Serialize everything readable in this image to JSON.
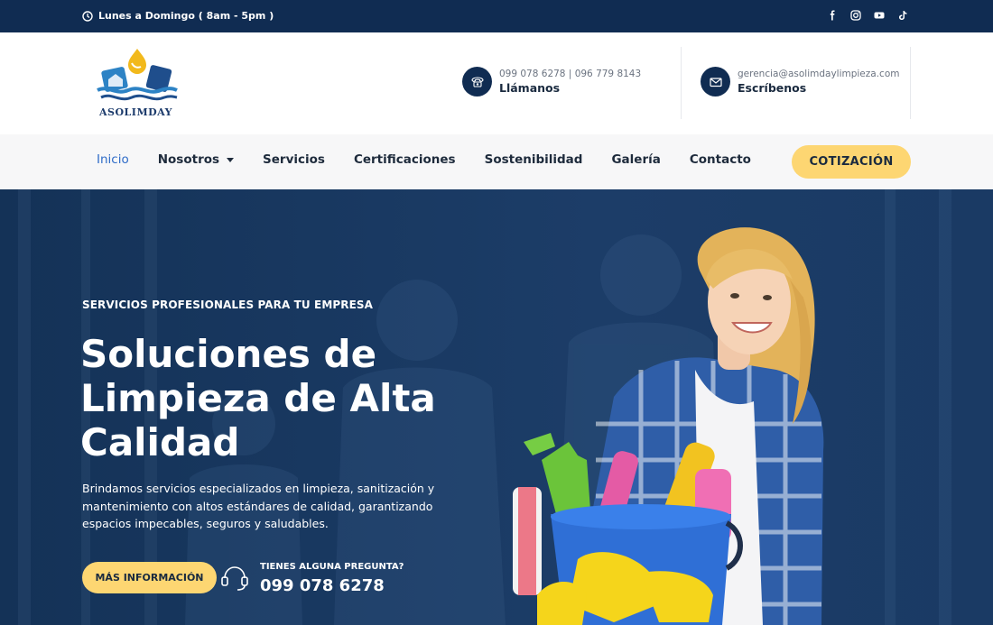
{
  "topbar": {
    "hours": "Lunes a Domingo ( 8am - 5pm )",
    "social": [
      "facebook-icon",
      "instagram-icon",
      "youtube-icon",
      "tiktok-icon"
    ]
  },
  "header": {
    "logo_text": "ASOLIMDAY",
    "phone": {
      "numbers": "099 078 6278 | 096 779 8143",
      "label": "Llámanos"
    },
    "email": {
      "address": "gerencia@asolimdaylimpieza.com",
      "label": "Escríbenos"
    }
  },
  "nav": {
    "items": [
      {
        "label": "Inicio",
        "active": true
      },
      {
        "label": "Nosotros",
        "dropdown": true
      },
      {
        "label": "Servicios"
      },
      {
        "label": "Certificaciones"
      },
      {
        "label": "Sostenibilidad"
      },
      {
        "label": "Galería"
      },
      {
        "label": "Contacto"
      }
    ],
    "cta": "COTIZACIÓN"
  },
  "hero": {
    "kicker": "SERVICIOS PROFESIONALES PARA TU EMPRESA",
    "title": "Soluciones de Limpieza de Alta Calidad",
    "description": "Brindamos servicios especializados en limpieza, sanitización y mantenimiento con altos estándares de calidad, garantizando espacios impecables, seguros y saludables.",
    "button": "MÁS INFORMACIÓN",
    "question_label": "TIENES ALGUNA PREGUNTA?",
    "question_phone": "099 078 6278"
  },
  "colors": {
    "navy": "#102c52",
    "hero_bg": "#1a3a64",
    "accent_yellow": "#fdd672",
    "active_link": "#2f6cc8"
  }
}
